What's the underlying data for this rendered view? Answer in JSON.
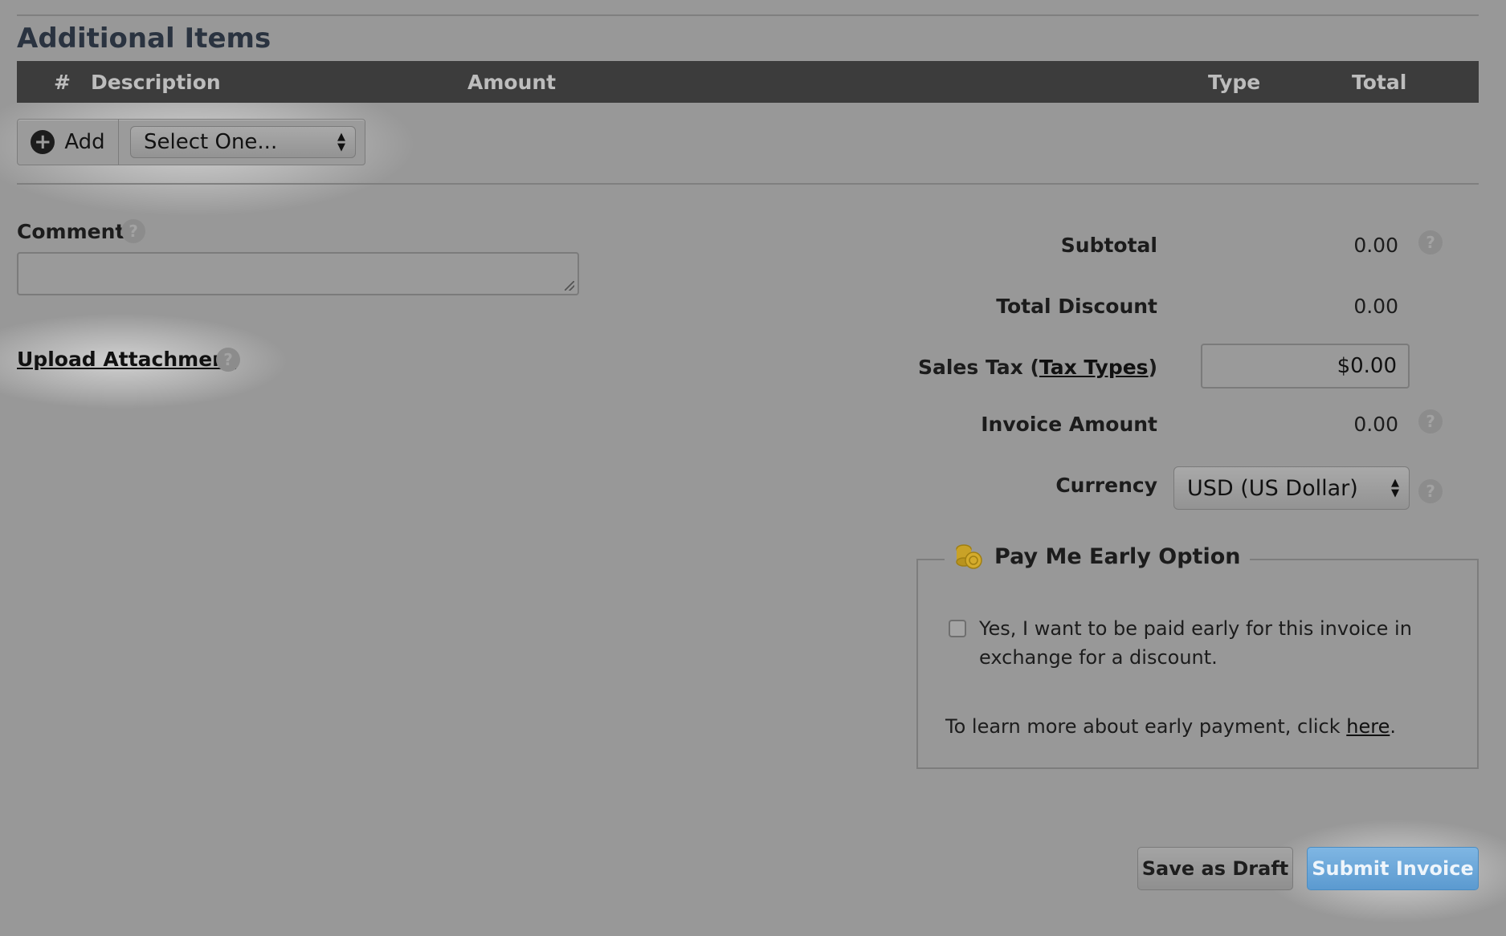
{
  "additional_items": {
    "title": "Additional Items",
    "columns": [
      "#",
      "Description",
      "Amount",
      "Type",
      "Total"
    ],
    "add_label": "Add",
    "select_value": "Select One..."
  },
  "comment": {
    "label": "Comment",
    "help": "?"
  },
  "upload": {
    "label": "Upload Attachment",
    "help": "?"
  },
  "summary": {
    "subtotal_label": "Subtotal",
    "subtotal_value": "0.00",
    "discount_label": "Total Discount",
    "discount_value": "0.00",
    "sales_tax_prefix": "Sales Tax (",
    "sales_tax_link": "Tax Types",
    "sales_tax_suffix": ")",
    "sales_tax_value": "$0.00",
    "invoice_amount_label": "Invoice Amount",
    "invoice_amount_value": "0.00",
    "currency_label": "Currency",
    "currency_value": "USD (US Dollar)"
  },
  "pay_early": {
    "title": "Pay Me Early Option",
    "icon": "coins-icon",
    "checkbox_label_line1": "Yes, I want to be paid early for this invoice in",
    "checkbox_label_line2": "exchange for a discount.",
    "checked": false,
    "learn_more_prefix": "To learn more about early payment, click ",
    "learn_more_link": "here",
    "learn_more_suffix": "."
  },
  "actions": {
    "save_draft": "Save as Draft",
    "submit": "Submit Invoice"
  },
  "colors": {
    "background": "#989898",
    "header_bar": "#3c3c3c",
    "submit": "#6aa8dc",
    "coin": "#c9a227"
  }
}
